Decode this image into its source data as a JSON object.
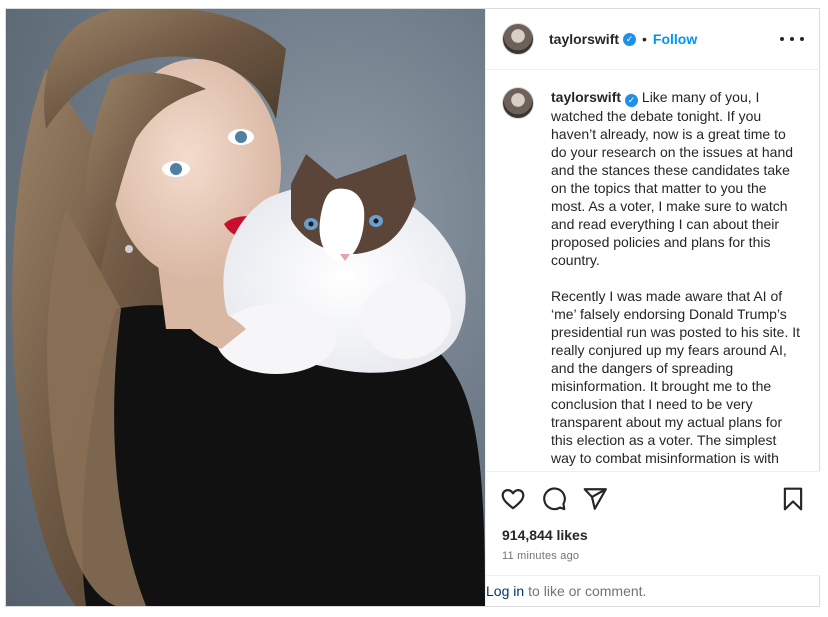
{
  "post": {
    "author": {
      "username": "taylorswift",
      "verified_icon": "verified-badge-icon"
    },
    "follow_label": "Follow",
    "separator": "•",
    "more_icon": "more-options-icon",
    "caption": {
      "username": "taylorswift",
      "paragraphs": [
        "Like many of you, I watched the debate tonight. If you haven’t already, now is a great time to do your research on the issues at hand and the stances these candidates take on the topics that matter to you the most. As a voter, I make sure to watch and read everything I can about their proposed policies and plans for this country.",
        "Recently I was made aware that AI of ‘me’ falsely endorsing Donald Trump’s presidential run was posted to his site. It really conjured up my fears around AI, and the dangers of spreading misinformation. It brought me to the conclusion that I need to be very transparent about my actual plans for this election as a voter. The simplest way to combat misinformation is with the truth."
      ]
    },
    "actions": {
      "like_icon": "heart-icon",
      "comment_icon": "comment-icon",
      "share_icon": "share-icon",
      "save_icon": "bookmark-icon"
    },
    "likes": "914,844 likes",
    "timestamp": "11 minutes ago",
    "login": {
      "link_text": "Log in",
      "suffix": "to like or comment."
    },
    "colors": {
      "link_blue": "#0095f6",
      "verified_blue": "#1f8fe8",
      "muted_text": "#737373",
      "border": "#dbdbdb"
    }
  }
}
